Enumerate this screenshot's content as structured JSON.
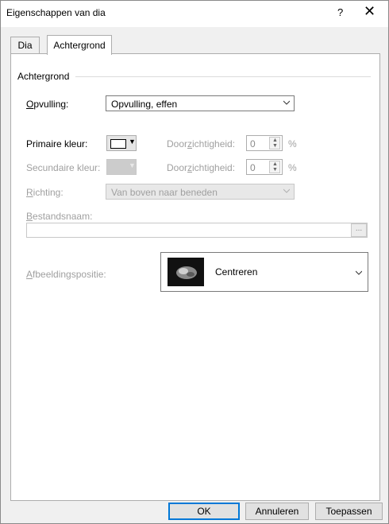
{
  "window": {
    "title": "Eigenschappen van dia",
    "help_label": "?",
    "close_label": "✕"
  },
  "tabs": [
    {
      "label": "Dia"
    },
    {
      "label": "Achtergrond"
    }
  ],
  "group": {
    "label": "Achtergrond"
  },
  "fill": {
    "label": "Opvulling:",
    "value": "Opvulling, effen"
  },
  "primary": {
    "label": "Primaire kleur:",
    "transparency_label": "Doorzichtigheid:",
    "transparency_value": "0",
    "percent": "%"
  },
  "secondary": {
    "label": "Secundaire kleur:",
    "transparency_label": "Doorzichtigheid:",
    "transparency_value": "0",
    "percent": "%"
  },
  "direction": {
    "label": "Richting:",
    "value": "Van boven naar beneden"
  },
  "filename": {
    "label": "Bestandsnaam:",
    "value": "",
    "browse_label": "..."
  },
  "image_position": {
    "label": "Afbeeldingspositie:",
    "value": "Centreren"
  },
  "buttons": {
    "ok": "OK",
    "cancel": "Annuleren",
    "apply": "Toepassen"
  },
  "colors": {
    "accent": "#0078d7",
    "primary_color": "#ffffff"
  }
}
